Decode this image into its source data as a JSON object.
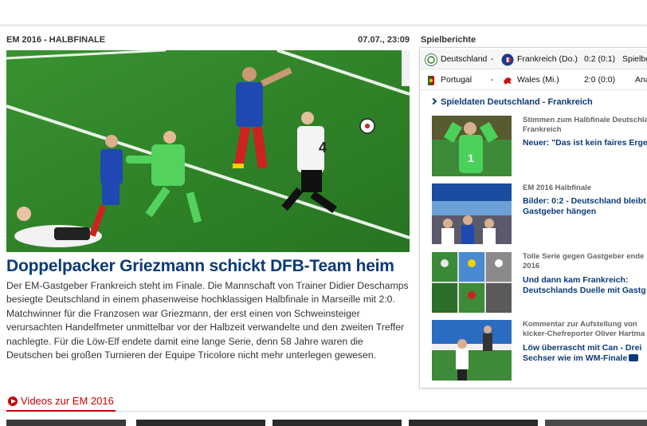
{
  "article": {
    "kicker": "EM 2016 - HALBFINALE",
    "date": "07.07., 23:09",
    "headline": "Doppelpacker Griezmann schickt DFB-Team heim",
    "teaser": "Der EM-Gastgeber Frankreich steht im Finale. Die Mannschaft von Trainer Didier Deschamps besiegte Deutschland in einem phasenweise hochklassigen Halbfinale in Marseille mit 2:0. Matchwinner für die Franzosen war Griezmann, der erst einen von Schweinsteiger verursachten Handelfmeter unmittelbar vor der Halbzeit verwandelte und den zweiten Treffer nachlegte. Für die Löw-Elf endete damit eine lange Serie, denn 58 Jahre waren die Deutschen bei großen Turnieren der Equipe Tricolore nicht mehr unterlegen gewesen."
  },
  "sidebar": {
    "title": "Spielberichte",
    "matches": [
      {
        "home": "Deutschland",
        "away": "Frankreich (Do.)",
        "score": "0:2 (0:1)",
        "link": "Spielbe"
      },
      {
        "home": "Portugal",
        "away": "Wales (Mi.)",
        "score": "2:0 (0:0)",
        "link": "Ana"
      }
    ],
    "spieldaten": "Spieldaten Deutschland - Frankreich",
    "stories": [
      {
        "kicker": "Stimmen zum Halbfinale Deutschland-Frankreich",
        "title": "Neuer: \"Das ist kein faires Ergeb"
      },
      {
        "kicker": "EM 2016 Halbfinale",
        "title": "Bilder: 0:2 - Deutschland bleibt an Gastgeber hängen"
      },
      {
        "kicker": "Tolle Serie gegen Gastgeber ende 2016",
        "title": "Und dann kam Frankreich: Deutschlands Duelle mit Gastg"
      },
      {
        "kicker": "Kommentar zur Aufstellung von kicker-Chefreporter Oliver Hartma",
        "title": "Löw überrascht mit Can - Drei Sechser wie im WM-Finale"
      }
    ]
  },
  "videos": {
    "label": "Videos zur EM 2016"
  },
  "colors": {
    "accent_blue": "#0b3a78",
    "accent_red": "#cc0000",
    "pitch": "#2f8a2a"
  },
  "icons": [
    "germany-flag-icon",
    "france-flag-icon",
    "portugal-flag-icon",
    "wales-flag-icon",
    "chevron-right-icon",
    "play-icon",
    "comment-icon"
  ]
}
